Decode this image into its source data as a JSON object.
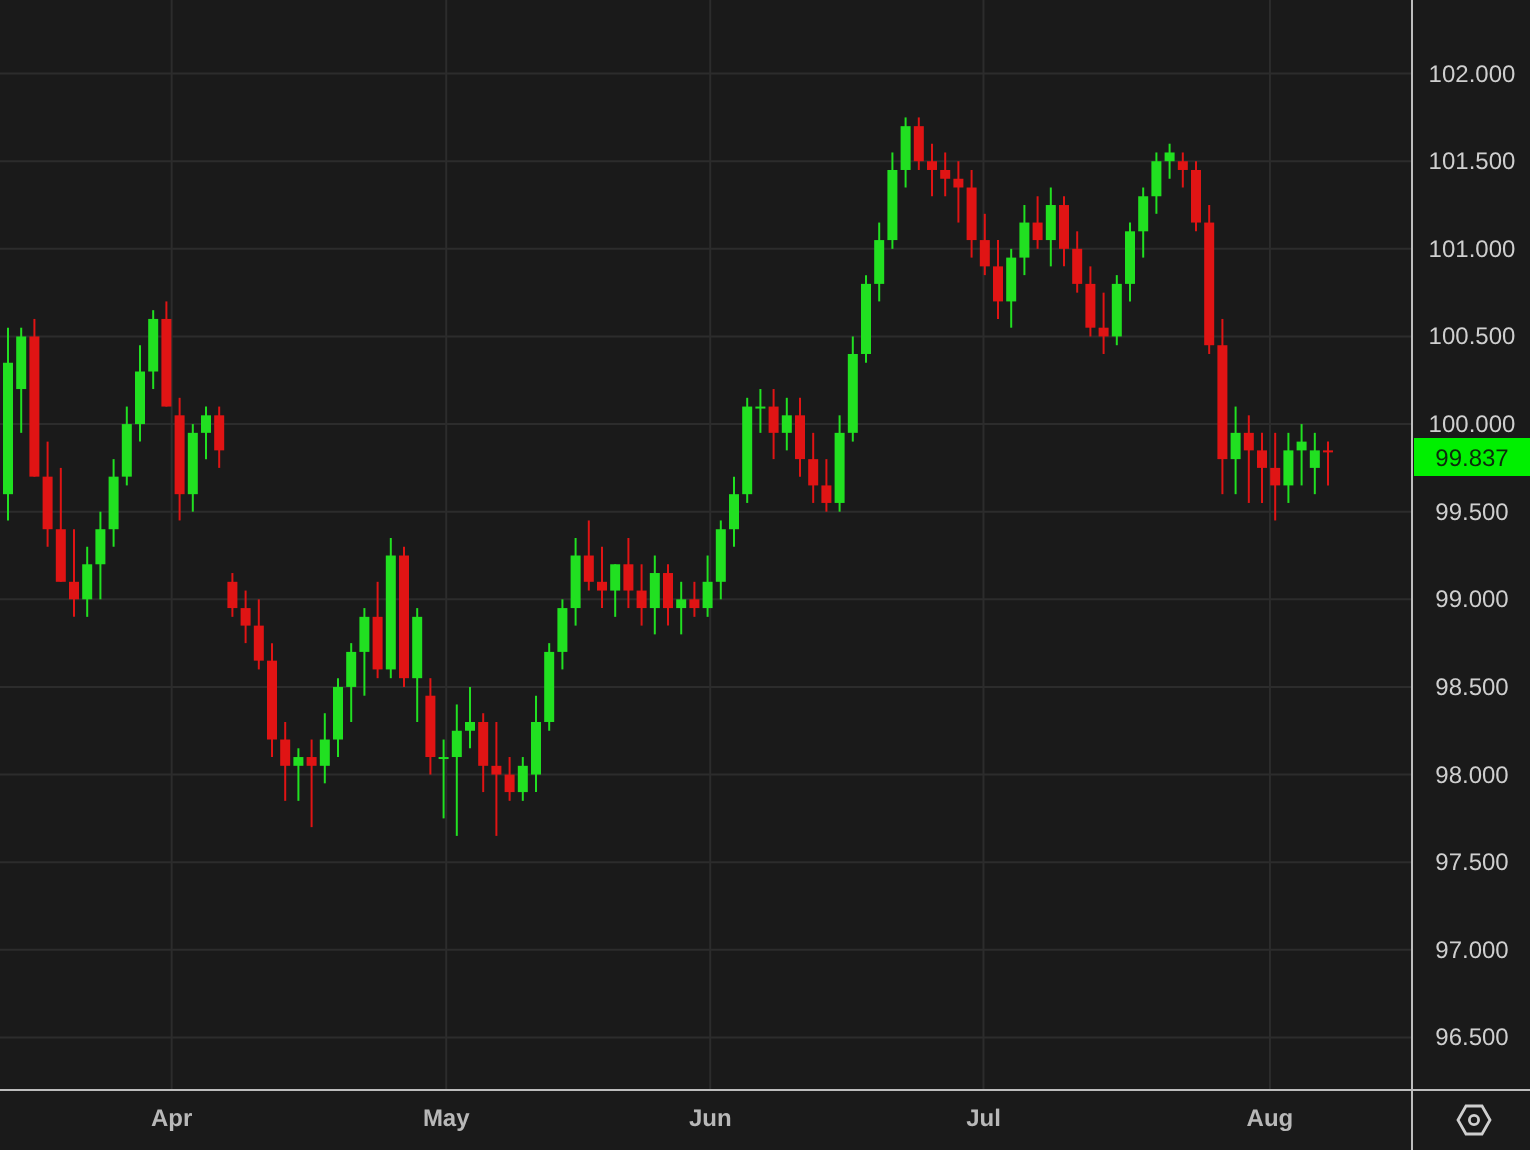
{
  "chart": {
    "chart_data": {
      "type": "candlestick",
      "yticks": [
        {
          "value": 102,
          "label": "102.000"
        },
        {
          "value": 101.5,
          "label": "101.500"
        },
        {
          "value": 101,
          "label": "101.000"
        },
        {
          "value": 100.5,
          "label": "100.500"
        },
        {
          "value": 100,
          "label": "100.000"
        },
        {
          "value": 99.5,
          "label": "99.500"
        },
        {
          "value": 99,
          "label": "99.000"
        },
        {
          "value": 98.5,
          "label": "98.500"
        },
        {
          "value": 98,
          "label": "98.000"
        },
        {
          "value": 97.5,
          "label": "97.500"
        },
        {
          "value": 97,
          "label": "97.000"
        },
        {
          "value": 96.5,
          "label": "96.500"
        }
      ],
      "ylim": [
        96.2,
        102.42
      ],
      "grid": true,
      "ohlc": [
        [
          99.6,
          100.55,
          99.45,
          100.35
        ],
        [
          100.2,
          100.55,
          99.95,
          100.5
        ],
        [
          100.5,
          100.6,
          99.7,
          99.7
        ],
        [
          99.7,
          99.9,
          99.3,
          99.4
        ],
        [
          99.4,
          99.75,
          99.1,
          99.1
        ],
        [
          99.1,
          99.4,
          98.9,
          99.0
        ],
        [
          99.0,
          99.3,
          98.9,
          99.2
        ],
        [
          99.2,
          99.5,
          99.0,
          99.4
        ],
        [
          99.4,
          99.8,
          99.3,
          99.7
        ],
        [
          99.7,
          100.1,
          99.65,
          100.0
        ],
        [
          100.0,
          100.45,
          99.9,
          100.3
        ],
        [
          100.3,
          100.65,
          100.2,
          100.6
        ],
        [
          100.6,
          100.7,
          100.1,
          100.1
        ],
        [
          100.05,
          100.15,
          99.45,
          99.6
        ],
        [
          99.6,
          100.0,
          99.5,
          99.95
        ],
        [
          99.95,
          100.1,
          99.8,
          100.05
        ],
        [
          100.05,
          100.1,
          99.75,
          99.85
        ],
        [
          99.1,
          99.15,
          98.9,
          98.95
        ],
        [
          98.95,
          99.05,
          98.75,
          98.85
        ],
        [
          98.85,
          99.0,
          98.6,
          98.65
        ],
        [
          98.65,
          98.75,
          98.1,
          98.2
        ],
        [
          98.2,
          98.3,
          97.85,
          98.05
        ],
        [
          98.05,
          98.15,
          97.85,
          98.1
        ],
        [
          98.1,
          98.2,
          97.7,
          98.05
        ],
        [
          98.05,
          98.35,
          97.95,
          98.2
        ],
        [
          98.2,
          98.55,
          98.1,
          98.5
        ],
        [
          98.5,
          98.75,
          98.3,
          98.7
        ],
        [
          98.7,
          98.95,
          98.45,
          98.9
        ],
        [
          98.9,
          99.1,
          98.55,
          98.6
        ],
        [
          98.6,
          99.35,
          98.55,
          99.25
        ],
        [
          99.25,
          99.3,
          98.5,
          98.55
        ],
        [
          98.55,
          98.95,
          98.3,
          98.9
        ],
        [
          98.45,
          98.55,
          98.0,
          98.1
        ],
        [
          98.1,
          98.2,
          97.75,
          98.1
        ],
        [
          98.1,
          98.4,
          97.65,
          98.25
        ],
        [
          98.25,
          98.5,
          98.15,
          98.3
        ],
        [
          98.3,
          98.35,
          97.9,
          98.05
        ],
        [
          98.05,
          98.3,
          97.65,
          98.0
        ],
        [
          98.0,
          98.1,
          97.85,
          97.9
        ],
        [
          97.9,
          98.1,
          97.85,
          98.05
        ],
        [
          98.0,
          98.45,
          97.9,
          98.3
        ],
        [
          98.3,
          98.75,
          98.25,
          98.7
        ],
        [
          98.7,
          99.0,
          98.6,
          98.95
        ],
        [
          98.95,
          99.35,
          98.85,
          99.25
        ],
        [
          99.25,
          99.45,
          99.05,
          99.1
        ],
        [
          99.1,
          99.3,
          98.95,
          99.05
        ],
        [
          99.05,
          99.2,
          98.9,
          99.2
        ],
        [
          99.2,
          99.35,
          98.95,
          99.05
        ],
        [
          99.05,
          99.2,
          98.85,
          98.95
        ],
        [
          98.95,
          99.25,
          98.8,
          99.15
        ],
        [
          99.15,
          99.2,
          98.85,
          98.95
        ],
        [
          98.95,
          99.1,
          98.8,
          99.0
        ],
        [
          99.0,
          99.1,
          98.9,
          98.95
        ],
        [
          98.95,
          99.25,
          98.9,
          99.1
        ],
        [
          99.1,
          99.45,
          99.0,
          99.4
        ],
        [
          99.4,
          99.7,
          99.3,
          99.6
        ],
        [
          99.6,
          100.15,
          99.55,
          100.1
        ],
        [
          100.1,
          100.2,
          99.95,
          100.1
        ],
        [
          100.1,
          100.2,
          99.8,
          99.95
        ],
        [
          99.95,
          100.15,
          99.85,
          100.05
        ],
        [
          100.05,
          100.15,
          99.7,
          99.8
        ],
        [
          99.8,
          99.95,
          99.55,
          99.65
        ],
        [
          99.65,
          99.8,
          99.5,
          99.55
        ],
        [
          99.55,
          100.05,
          99.5,
          99.95
        ],
        [
          99.95,
          100.5,
          99.9,
          100.4
        ],
        [
          100.4,
          100.85,
          100.35,
          100.8
        ],
        [
          100.8,
          101.15,
          100.7,
          101.05
        ],
        [
          101.05,
          101.55,
          101.0,
          101.45
        ],
        [
          101.45,
          101.75,
          101.35,
          101.7
        ],
        [
          101.7,
          101.75,
          101.45,
          101.5
        ],
        [
          101.5,
          101.6,
          101.3,
          101.45
        ],
        [
          101.45,
          101.55,
          101.3,
          101.4
        ],
        [
          101.4,
          101.5,
          101.15,
          101.35
        ],
        [
          101.35,
          101.45,
          100.95,
          101.05
        ],
        [
          101.05,
          101.2,
          100.85,
          100.9
        ],
        [
          100.9,
          101.05,
          100.6,
          100.7
        ],
        [
          100.7,
          101.0,
          100.55,
          100.95
        ],
        [
          100.95,
          101.25,
          100.85,
          101.15
        ],
        [
          101.15,
          101.3,
          101.0,
          101.05
        ],
        [
          101.05,
          101.35,
          100.9,
          101.25
        ],
        [
          101.25,
          101.3,
          100.9,
          101.0
        ],
        [
          101.0,
          101.1,
          100.75,
          100.8
        ],
        [
          100.8,
          100.9,
          100.5,
          100.55
        ],
        [
          100.55,
          100.75,
          100.4,
          100.5
        ],
        [
          100.5,
          100.85,
          100.45,
          100.8
        ],
        [
          100.8,
          101.15,
          100.7,
          101.1
        ],
        [
          101.1,
          101.35,
          100.95,
          101.3
        ],
        [
          101.3,
          101.55,
          101.2,
          101.5
        ],
        [
          101.5,
          101.6,
          101.4,
          101.55
        ],
        [
          101.5,
          101.55,
          101.35,
          101.45
        ],
        [
          101.45,
          101.5,
          101.1,
          101.15
        ],
        [
          101.15,
          101.25,
          100.4,
          100.45
        ],
        [
          100.45,
          100.6,
          99.6,
          99.8
        ],
        [
          99.8,
          100.1,
          99.6,
          99.95
        ],
        [
          99.95,
          100.05,
          99.55,
          99.85
        ],
        [
          99.85,
          99.95,
          99.55,
          99.75
        ],
        [
          99.75,
          99.95,
          99.45,
          99.65
        ],
        [
          99.65,
          99.95,
          99.55,
          99.85
        ],
        [
          99.85,
          100.0,
          99.65,
          99.9
        ],
        [
          99.75,
          99.95,
          99.6,
          99.85
        ],
        [
          99.85,
          99.9,
          99.65,
          99.84
        ]
      ]
    },
    "x_axis_labels": [
      "Apr",
      "May",
      "Jun",
      "Jul",
      "Aug"
    ],
    "price_label": "99.837"
  }
}
